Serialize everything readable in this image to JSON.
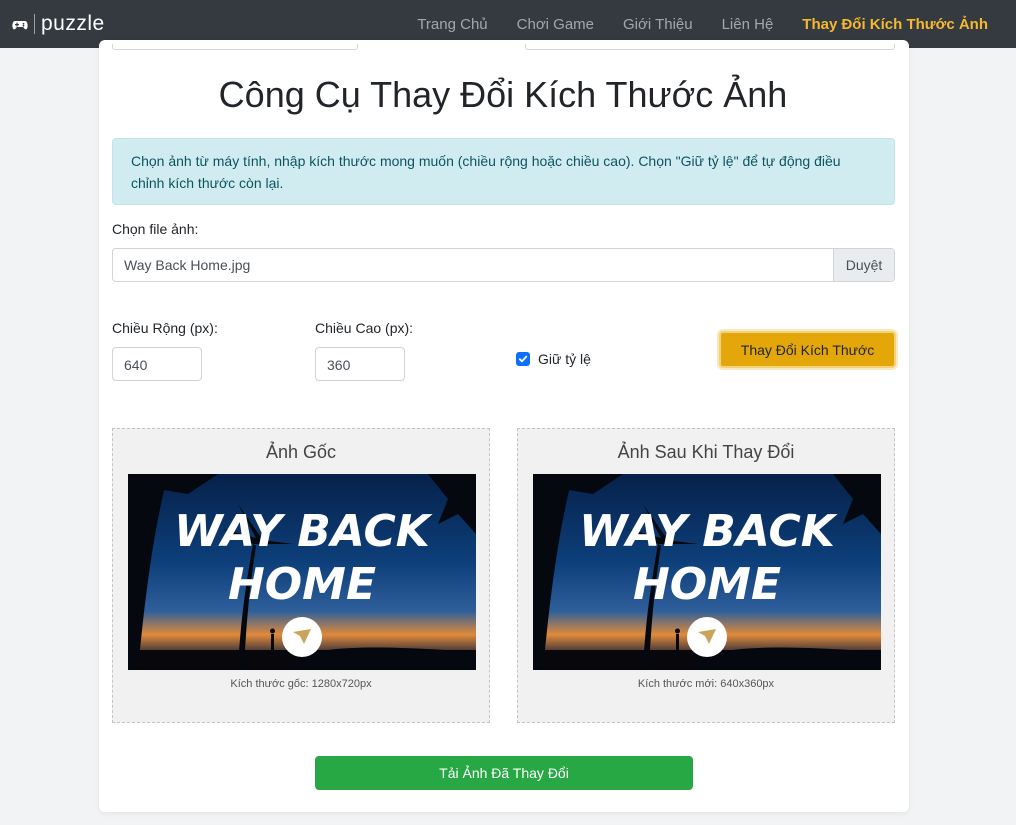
{
  "navbar": {
    "brand": "puzzle",
    "links": [
      {
        "label": "Trang Chủ"
      },
      {
        "label": "Chơi Game"
      },
      {
        "label": "Giới Thiệu"
      },
      {
        "label": "Liên Hệ"
      },
      {
        "label": "Thay Đổi Kích Thước Ảnh",
        "active": true
      }
    ],
    "active_color": "#f5b82e"
  },
  "page": {
    "title": "Công Cụ Thay Đổi Kích Thước Ảnh",
    "info": "Chọn ảnh từ máy tính, nhập kích thước mong muốn (chiều rộng hoặc chiều cao). Chọn \"Giữ tỷ lệ\" để tự động điều chỉnh kích thước còn lại."
  },
  "file": {
    "label": "Chọn file ảnh:",
    "value": "Way Back Home.jpg",
    "browse_label": "Duyệt"
  },
  "width": {
    "label": "Chiều Rộng (px):",
    "value": "640"
  },
  "height": {
    "label": "Chiều Cao (px):",
    "value": "360"
  },
  "keep_ratio": {
    "label": "Giữ tỷ lệ",
    "checked": true
  },
  "resize_button": {
    "label": "Thay Đổi Kích Thước",
    "color": "#e4a70a"
  },
  "original": {
    "title": "Ảnh Gốc",
    "image_text_line1": "WAY BACK",
    "image_text_line2": "HOME",
    "caption": "Kích thước gốc: 1280x720px"
  },
  "resized": {
    "title": "Ảnh Sau Khi Thay Đổi",
    "image_text_line1": "WAY BACK",
    "image_text_line2": "HOME",
    "caption": "Kích thước mới: 640x360px"
  },
  "download_button": {
    "label": "Tải Ảnh Đã Thay Đổi",
    "color": "#28a745"
  }
}
